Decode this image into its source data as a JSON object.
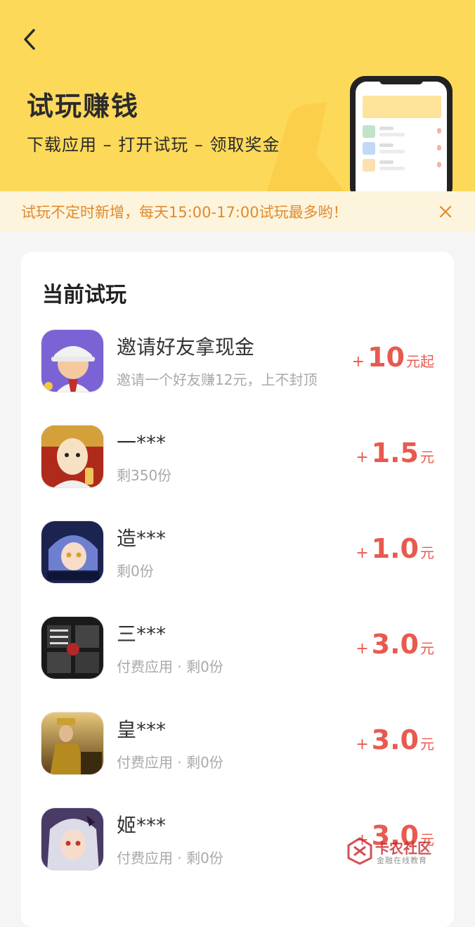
{
  "header": {
    "title": "试玩赚钱",
    "subtitle": "下载应用 – 打开试玩 – 领取奖金",
    "bg_color": "#fdd95a"
  },
  "notice": {
    "text": "试玩不定时新增，每天15:00-17:00试玩最多哟！",
    "color": "#e08a2c"
  },
  "section": {
    "title": "当前试玩"
  },
  "items": [
    {
      "name": "邀请好友拿现金",
      "desc": "邀请一个好友赚12元，上不封顶",
      "plus": "+",
      "amount": "10",
      "unit": "元起",
      "icon": "invite-character-icon"
    },
    {
      "name": "一***",
      "desc": "剩350份",
      "plus": "+",
      "amount": "1.5",
      "unit": "元",
      "icon": "bald-hero-game-icon"
    },
    {
      "name": "造***",
      "desc": "剩0份",
      "plus": "+",
      "amount": "1.0",
      "unit": "元",
      "icon": "anime-girl-game-icon"
    },
    {
      "name": "三***",
      "desc": "付费应用 · 剩0份",
      "plus": "+",
      "amount": "3.0",
      "unit": "元",
      "icon": "three-kingdoms-game-icon"
    },
    {
      "name": "皇***",
      "desc": "付费应用 · 剩0份",
      "plus": "+",
      "amount": "3.0",
      "unit": "元",
      "icon": "emperor-game-icon"
    },
    {
      "name": "姬***",
      "desc": "付费应用 · 剩0份",
      "plus": "+",
      "amount": "3.0",
      "unit": "元",
      "icon": "silver-hair-girl-game-icon"
    }
  ],
  "watermark": {
    "title": "卡农社区",
    "subtitle": "金融在线教育"
  },
  "colors": {
    "accent_red": "#e85a4f",
    "muted": "#a9a9a9"
  }
}
